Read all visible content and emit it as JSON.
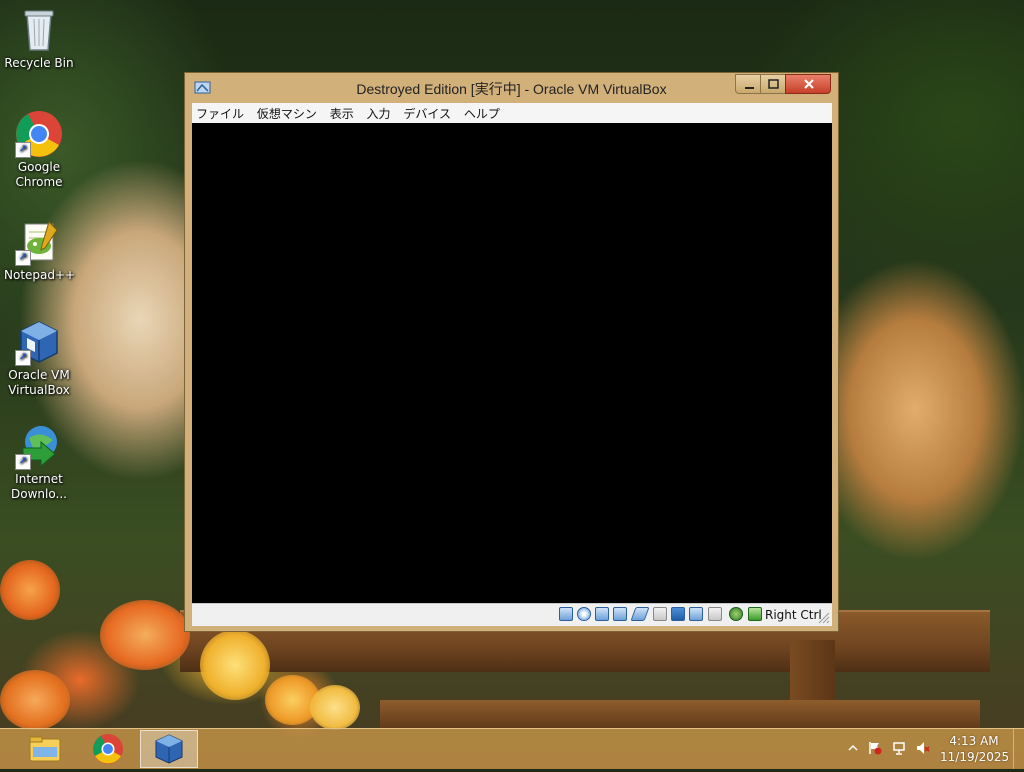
{
  "desktop": {
    "icons": [
      {
        "label": "Recycle Bin"
      },
      {
        "label": "Google Chrome"
      },
      {
        "label": "Notepad++"
      },
      {
        "label": "Oracle VM VirtualBox"
      },
      {
        "label": "Internet Downlo..."
      }
    ]
  },
  "window": {
    "title": "Destroyed Edition [実行中] - Oracle VM VirtualBox",
    "menu": [
      "ファイル",
      "仮想マシン",
      "表示",
      "入力",
      "デバイス",
      "ヘルプ"
    ],
    "status": {
      "host_key": "Right Ctrl",
      "icons": [
        "hard-disk-icon",
        "optical-drive-icon",
        "audio-icon",
        "network-icon",
        "usb-icon",
        "shared-folders-icon",
        "display-icon",
        "video-capture-icon",
        "mouse-integration-icon",
        "guest-additions-icon",
        "host-key-icon"
      ]
    }
  },
  "taskbar": {
    "pinned": [
      "file-explorer-icon",
      "chrome-icon",
      "virtualbox-icon"
    ],
    "active": "virtualbox-icon"
  },
  "tray": {
    "time": "4:13 AM",
    "date": "11/19/2025"
  },
  "colors": {
    "window_frame": "#d2b07a",
    "close_button": "#c7402a",
    "taskbar": "#c49448",
    "vm_screen": "#000000"
  }
}
